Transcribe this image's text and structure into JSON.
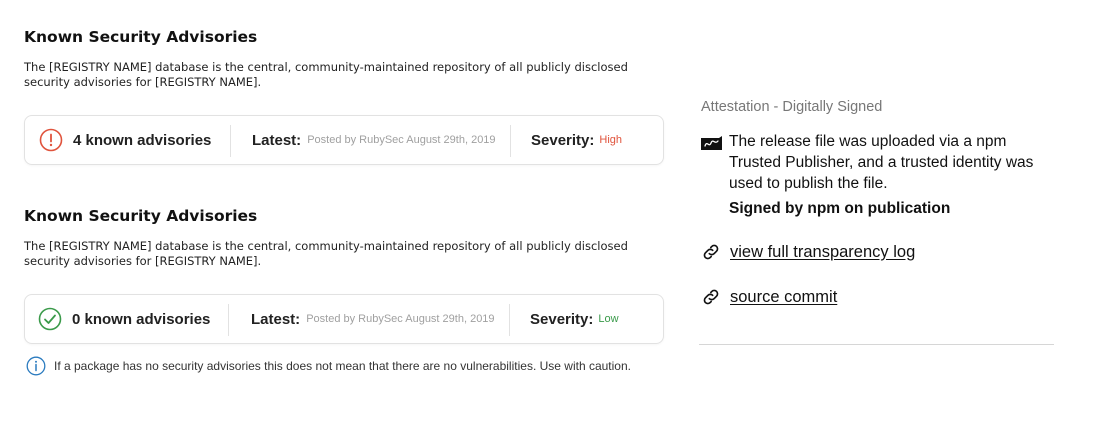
{
  "advisory_blocks": [
    {
      "title": "Known Security Advisories",
      "description": "The [REGISTRY NAME] database is the central, community-maintained repository of all publicly disclosed security advisories for [REGISTRY NAME].",
      "count_text": "4 known advisories",
      "status_icon": "alert-circle-icon",
      "latest_label": "Latest:",
      "latest_value": "Posted by RubySec August 29th, 2019",
      "severity_label": "Severity:",
      "severity_value": "High",
      "severity_color": "#e0533c"
    },
    {
      "title": "Known Security Advisories",
      "description": "The [REGISTRY NAME] database is the central, community-maintained repository of all publicly disclosed security advisories for [REGISTRY NAME].",
      "count_text": "0 known advisories",
      "status_icon": "check-circle-icon",
      "latest_label": "Latest:",
      "latest_value": "Posted by RubySec August 29th, 2019",
      "severity_label": "Severity:",
      "severity_value": "Low",
      "severity_color": "#3a9a4a"
    }
  ],
  "note": {
    "icon": "info-icon",
    "text": "If a package has no security advisories this does not mean that there are no vulnerabilities. Use with caution."
  },
  "attestation": {
    "title": "Attestation - Digitally Signed",
    "icon": "signature-icon",
    "text": "The release file was uploaded via a npm Trusted Publisher, and a trusted identity was used to publish the file.",
    "signed_by": "Signed by npm on publication",
    "links": [
      {
        "icon": "link-icon",
        "label": "view full transparency log"
      },
      {
        "icon": "link-icon",
        "label": "source commit"
      }
    ]
  },
  "colors": {
    "alert": "#e0533c",
    "ok": "#3a9a4a",
    "info": "#2b7bbf"
  }
}
